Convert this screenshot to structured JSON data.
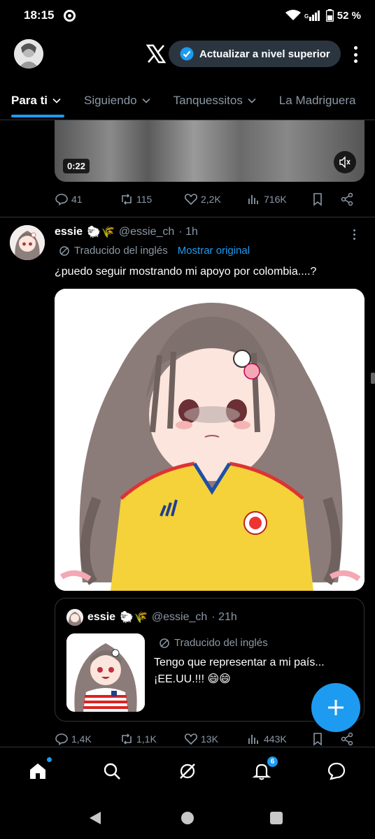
{
  "status": {
    "time": "18:15",
    "battery": "52 %"
  },
  "header": {
    "upgrade_label": "Actualizar a nivel superior"
  },
  "tabs": [
    {
      "label": "Para ti"
    },
    {
      "label": "Siguiendo"
    },
    {
      "label": "Tanquessitos"
    },
    {
      "label": "La Madriguera"
    }
  ],
  "tweet1": {
    "video_duration": "0:22",
    "replies": "41",
    "reposts": "115",
    "likes": "2,2K",
    "views": "716K"
  },
  "tweet2": {
    "name": "essie",
    "emoji": "🐑🌾",
    "handle": "@essie_ch",
    "time": "· 1h",
    "translated_label": "Traducido del inglés",
    "show_original": "Mostrar original",
    "text": "¿puedo seguir mostrando mi apoyo por colombia....?",
    "quote": {
      "name": "essie",
      "emoji": "🐑🌾",
      "handle": "@essie_ch",
      "time": "· 21h",
      "translated_label": "Traducido del inglés",
      "text": "Tengo que representar a mi país... ¡EE.UU.!!! 😄😄"
    },
    "replies": "1,4K",
    "reposts": "1,1K",
    "likes": "13K",
    "views": "443K"
  },
  "nav": {
    "notifications_count": "6"
  },
  "colors": {
    "accent": "#1d9bf0",
    "background": "#000000",
    "muted": "#8b98a5"
  }
}
